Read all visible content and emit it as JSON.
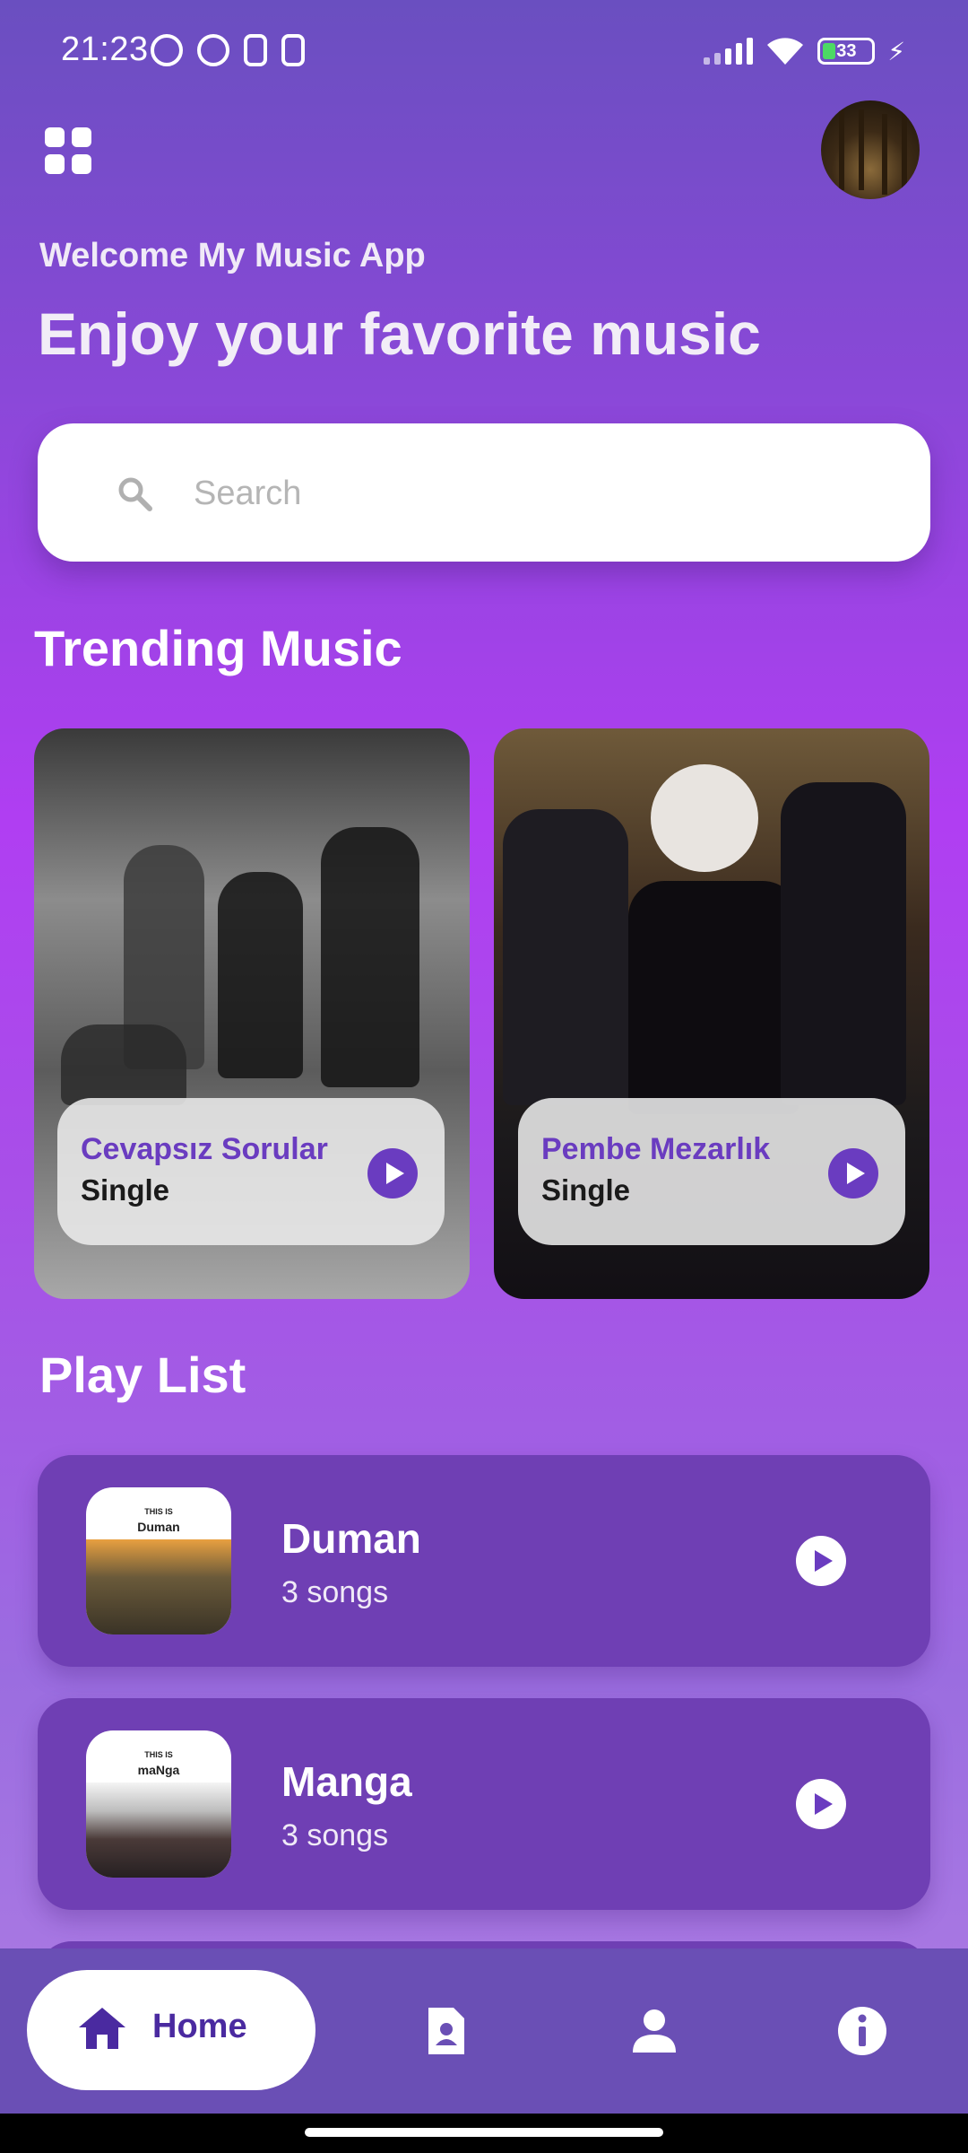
{
  "status_bar": {
    "time": "21:23",
    "battery": "33"
  },
  "header": {
    "welcome": "Welcome My Music App",
    "headline": "Enjoy your favorite music"
  },
  "search": {
    "placeholder": "Search",
    "value": ""
  },
  "trending": {
    "title": "Trending Music",
    "cards": [
      {
        "title": "Cevapsız Sorular",
        "subtitle": "Single"
      },
      {
        "title": "Pembe Mezarlık",
        "subtitle": "Single"
      }
    ]
  },
  "playlist": {
    "title": "Play List",
    "items": [
      {
        "name": "Duman",
        "count": "3 songs",
        "cover_caption_top": "THIS IS",
        "cover_caption": "Duman"
      },
      {
        "name": "Manga",
        "count": "3 songs",
        "cover_caption_top": "THIS IS",
        "cover_caption": "maNga"
      }
    ]
  },
  "nav": {
    "home_label": "Home"
  },
  "colors": {
    "accent": "#6a3cc0",
    "nav_bg": "#6a4fb5",
    "playlist_bg": "#6f3fb4"
  }
}
